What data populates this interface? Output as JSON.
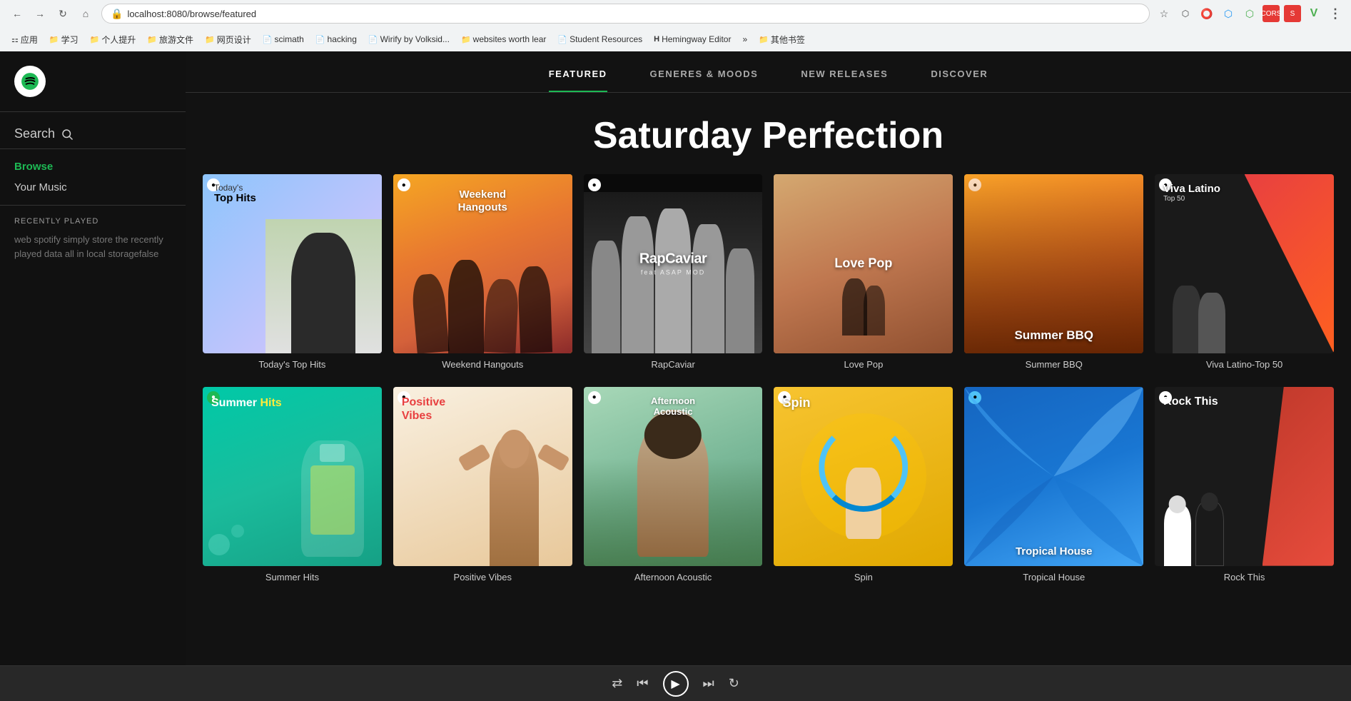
{
  "browser": {
    "url": "localhost:8080/browse/featured",
    "nav_back": "←",
    "nav_forward": "→",
    "nav_refresh": "↻",
    "nav_home": "⌂",
    "bookmarks": [
      {
        "icon": "⚏",
        "label": "应用"
      },
      {
        "icon": "📁",
        "label": "学习"
      },
      {
        "icon": "📁",
        "label": "个人提升"
      },
      {
        "icon": "📁",
        "label": "旅游文件"
      },
      {
        "icon": "📁",
        "label": "网页设计"
      },
      {
        "icon": "📄",
        "label": "scimath"
      },
      {
        "icon": "📄",
        "label": "hacking"
      },
      {
        "icon": "📄",
        "label": ""
      },
      {
        "icon": "📄",
        "label": "Wirify by Volksid..."
      },
      {
        "icon": "📁",
        "label": "websites worth lear"
      },
      {
        "icon": "📄",
        "label": ""
      },
      {
        "icon": "📄",
        "label": "Student Resources"
      },
      {
        "icon": "H",
        "label": "Hemingway Editor"
      },
      {
        "icon": "»",
        "label": ""
      },
      {
        "icon": "📁",
        "label": "其他书签"
      }
    ]
  },
  "sidebar": {
    "logo_text": "♫",
    "search_label": "Search",
    "nav_items": [
      {
        "label": "Browse",
        "active": true,
        "id": "browse"
      },
      {
        "label": "Your Music",
        "active": false,
        "id": "your-music"
      }
    ],
    "recently_played_label": "RECENTLY PLAYED",
    "recently_played_text": "web spotify simply store the recently played data all in local storagefalse"
  },
  "main_nav": {
    "tabs": [
      {
        "label": "FEATURED",
        "active": true
      },
      {
        "label": "GENERES & MOODS",
        "active": false
      },
      {
        "label": "NEW RELEASES",
        "active": false
      },
      {
        "label": "DISCOVER",
        "active": false
      }
    ]
  },
  "featured": {
    "title": "Saturday Perfection",
    "playlists_row1": [
      {
        "id": "top-hits",
        "name": "Today's Top Hits",
        "theme": "top-hits"
      },
      {
        "id": "weekend-hangouts",
        "name": "Weekend Hangouts",
        "theme": "weekend"
      },
      {
        "id": "rapcaviar",
        "name": "RapCaviar",
        "theme": "rapcaviar"
      },
      {
        "id": "love-pop",
        "name": "Love Pop",
        "theme": "lovepop"
      },
      {
        "id": "summer-bbq",
        "name": "Summer BBQ",
        "theme": "summerbbq"
      },
      {
        "id": "viva-latino",
        "name": "Viva Latino-Top 50",
        "theme": "vivalatino"
      }
    ],
    "playlists_row2": [
      {
        "id": "summer-hits",
        "name": "Summer Hits",
        "theme": "summerhits"
      },
      {
        "id": "positive-vibes",
        "name": "Positive Vibes",
        "theme": "posvibes"
      },
      {
        "id": "afternoon-acoustic",
        "name": "Afternoon Acoustic",
        "theme": "afternoon"
      },
      {
        "id": "spin",
        "name": "Spin",
        "theme": "spin"
      },
      {
        "id": "tropical-house",
        "name": "Tropical House",
        "theme": "tropical"
      },
      {
        "id": "rock-this",
        "name": "Rock This",
        "theme": "rockthis"
      }
    ]
  },
  "player": {
    "shuffle": "⇄",
    "prev": "⏮",
    "play": "▶",
    "next": "⏭",
    "repeat": "↻"
  }
}
